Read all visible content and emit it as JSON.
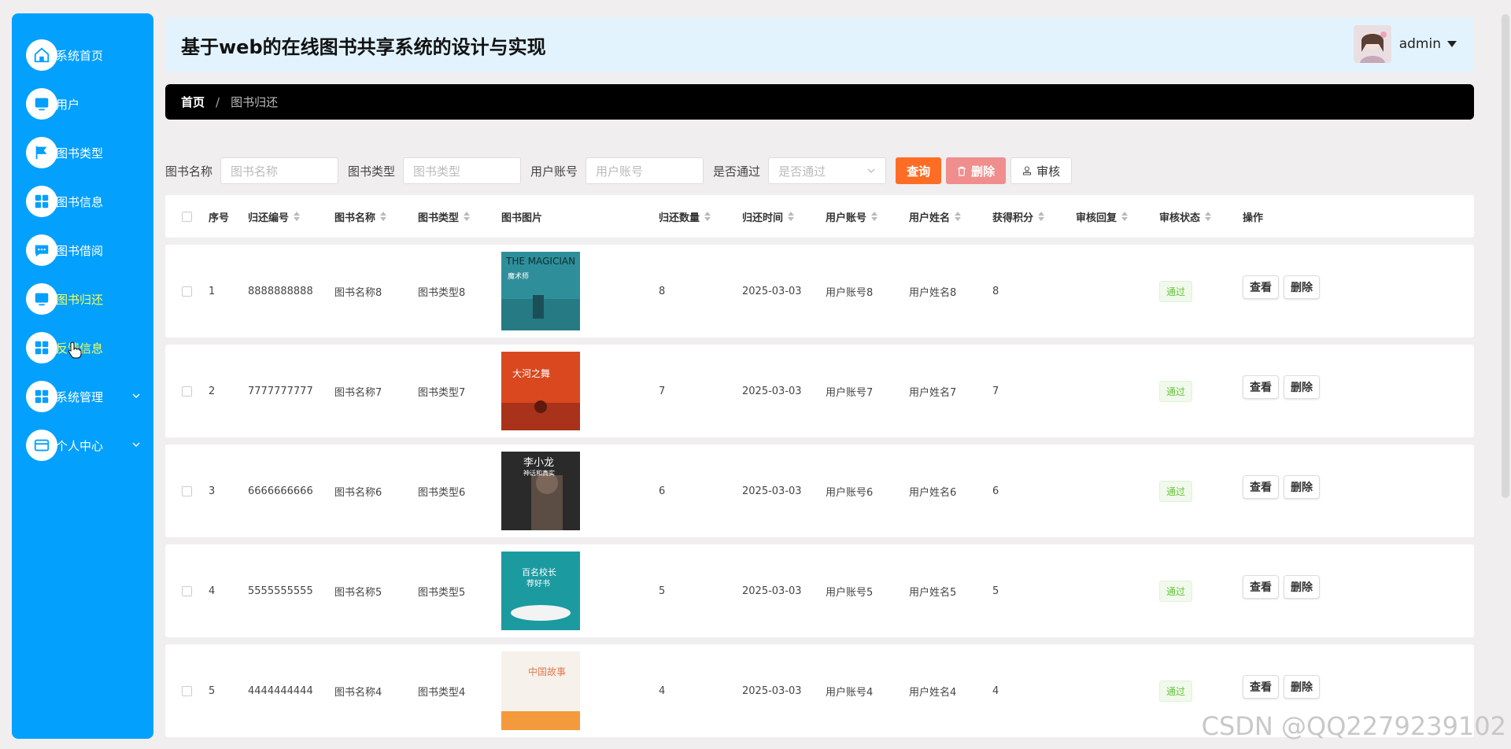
{
  "sidebar": {
    "items": [
      {
        "label": "系统首页",
        "icon": "home-icon"
      },
      {
        "label": "用户",
        "icon": "monitor-icon"
      },
      {
        "label": "图书类型",
        "icon": "flag-icon"
      },
      {
        "label": "图书信息",
        "icon": "grid-icon"
      },
      {
        "label": "图书借阅",
        "icon": "chat-icon"
      },
      {
        "label": "图书归还",
        "icon": "monitor-icon"
      },
      {
        "label": "反馈信息",
        "icon": "grid-icon"
      },
      {
        "label": "系统管理",
        "icon": "grid-icon"
      },
      {
        "label": "个人中心",
        "icon": "card-icon"
      }
    ],
    "active_index": 5,
    "colors": {
      "bg": "#03a0fd",
      "active_text": "#f7ff5b"
    }
  },
  "header": {
    "title": "基于web的在线图书共享系统的设计与实现",
    "user_name": "admin"
  },
  "breadcrumb": {
    "home": "首页",
    "separator": "/",
    "current": "图书归还"
  },
  "search": {
    "book_name_label": "图书名称",
    "book_name_placeholder": "图书名称",
    "book_type_label": "图书类型",
    "book_type_placeholder": "图书类型",
    "user_account_label": "用户账号",
    "user_account_placeholder": "用户账号",
    "approved_label": "是否通过",
    "approved_placeholder": "是否通过",
    "query_btn": "查询",
    "delete_btn": "删除",
    "audit_btn": "审核"
  },
  "table": {
    "headers": {
      "idx": "序号",
      "return_no": "归还编号",
      "book_name": "图书名称",
      "book_type": "图书类型",
      "book_img": "图书图片",
      "return_qty": "归还数量",
      "return_time": "归还时间",
      "user_account": "用户账号",
      "user_name": "用户姓名",
      "points": "获得积分",
      "audit_reply": "审核回复",
      "audit_status": "审核状态",
      "actions": "操作"
    },
    "rows": [
      {
        "idx": "1",
        "return_no": "8888888888",
        "book_name": "图书名称8",
        "book_type": "图书类型8",
        "qty": "8",
        "time": "2025-03-03",
        "account": "用户账号8",
        "user": "用户姓名8",
        "points": "8",
        "reply": "",
        "status": "通过",
        "cover_text": "THE MAGICIAN",
        "cover_sub": "魔术师",
        "cover_color": "#2e8f9a"
      },
      {
        "idx": "2",
        "return_no": "7777777777",
        "book_name": "图书名称7",
        "book_type": "图书类型7",
        "qty": "7",
        "time": "2025-03-03",
        "account": "用户账号7",
        "user": "用户姓名7",
        "points": "7",
        "reply": "",
        "status": "通过",
        "cover_text": "大河之舞",
        "cover_sub": "",
        "cover_color": "#d9481e"
      },
      {
        "idx": "3",
        "return_no": "6666666666",
        "book_name": "图书名称6",
        "book_type": "图书类型6",
        "qty": "6",
        "time": "2025-03-03",
        "account": "用户账号6",
        "user": "用户姓名6",
        "points": "6",
        "reply": "",
        "status": "通过",
        "cover_text": "李小龙",
        "cover_sub": "神话和真实",
        "cover_color": "#2a2a2a"
      },
      {
        "idx": "4",
        "return_no": "5555555555",
        "book_name": "图书名称5",
        "book_type": "图书类型5",
        "qty": "5",
        "time": "2025-03-03",
        "account": "用户账号5",
        "user": "用户姓名5",
        "points": "5",
        "reply": "",
        "status": "通过",
        "cover_text": "百名校长",
        "cover_sub": "荐好书",
        "cover_color": "#1b9aa0"
      },
      {
        "idx": "5",
        "return_no": "4444444444",
        "book_name": "图书名称4",
        "book_type": "图书类型4",
        "qty": "4",
        "time": "2025-03-03",
        "account": "用户账号4",
        "user": "用户姓名4",
        "points": "4",
        "reply": "",
        "status": "通过",
        "cover_text": "中国故事",
        "cover_sub": "",
        "cover_color": "#f6f1ea"
      }
    ],
    "view_btn": "查看",
    "delete_btn": "删除"
  },
  "watermark": "CSDN @QQ2279239102"
}
